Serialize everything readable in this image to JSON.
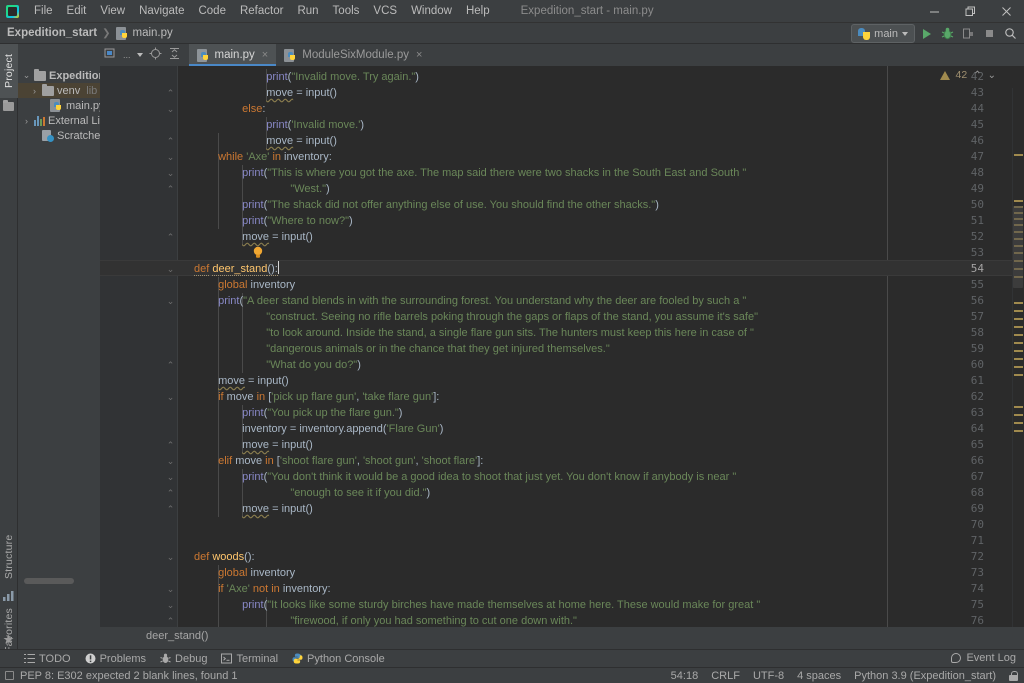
{
  "titlebar": {
    "window_title": "Expedition_start - main.py",
    "logo_name": "pycharm-logo",
    "menus": [
      "File",
      "Edit",
      "View",
      "Navigate",
      "Code",
      "Refactor",
      "Run",
      "Tools",
      "VCS",
      "Window",
      "Help"
    ],
    "controls": [
      "minimize",
      "maximize",
      "close"
    ]
  },
  "navbar": {
    "project": "Expedition_start",
    "separator": "❯",
    "file": "main.py"
  },
  "runbar": {
    "config_name": "main",
    "buttons": [
      "run",
      "debug",
      "run-coverage",
      "stop",
      "search-everywhere"
    ]
  },
  "left_tool_strip": {
    "tabs": [
      "Project",
      "Structure",
      "Favorites"
    ],
    "selected": "Project"
  },
  "project_pane": {
    "toolbar_label": "...",
    "tree": [
      {
        "indent": 0,
        "twisty": "⌄",
        "icon": "folder-icon",
        "label": "Expedition",
        "bold": true,
        "selected": false
      },
      {
        "indent": 1,
        "twisty": "›",
        "icon": "folder-icon",
        "label": "venv",
        "suffix": "lib",
        "selected": true
      },
      {
        "indent": 2,
        "twisty": "",
        "icon": "python-file-icon",
        "label": "main.py",
        "selected": false
      },
      {
        "indent": 0,
        "twisty": "›",
        "icon": "library-icon",
        "label": "External Lib",
        "selected": false
      },
      {
        "indent": 1,
        "twisty": "",
        "icon": "scratches-icon",
        "label": "Scratches an",
        "selected": false
      }
    ]
  },
  "editor": {
    "tabs": [
      {
        "label": "main.py",
        "active": true,
        "icon": "python-file-icon",
        "close": "×"
      },
      {
        "label": "ModuleSixModule.py",
        "active": false,
        "icon": "python-file-icon",
        "close": "×"
      }
    ],
    "toolbar_icons": [
      "select-in-icon",
      "locate-icon",
      "collapse-all-icon"
    ],
    "inspections": {
      "warning_count": "42",
      "up": "⌃",
      "down": "⌄"
    },
    "breadcrumb": "deer_stand()",
    "current_line": 54,
    "first_line": 42,
    "lines": [
      {
        "n": 42,
        "fold": "",
        "indent": 3,
        "tokens": [
          {
            "t": "print",
            "c": "call"
          },
          {
            "t": "(",
            "c": "id"
          },
          {
            "t": "\"Invalid move. Try again.\"",
            "c": "s"
          },
          {
            "t": ")",
            "c": "id"
          }
        ]
      },
      {
        "n": 43,
        "fold": "⌃",
        "indent": 3,
        "tokens": [
          {
            "t": "move",
            "c": "id warnu"
          },
          {
            "t": " = ",
            "c": "id"
          },
          {
            "t": "input",
            "c": "id"
          },
          {
            "t": "()",
            "c": "id"
          }
        ]
      },
      {
        "n": 44,
        "fold": "⌄",
        "indent": 2,
        "tokens": [
          {
            "t": "else",
            "c": "k"
          },
          {
            "t": ":",
            "c": "id"
          }
        ]
      },
      {
        "n": 45,
        "fold": "",
        "indent": 3,
        "tokens": [
          {
            "t": "print",
            "c": "call"
          },
          {
            "t": "(",
            "c": "id"
          },
          {
            "t": "'Invalid move.'",
            "c": "s"
          },
          {
            "t": ")",
            "c": "id"
          }
        ]
      },
      {
        "n": 46,
        "fold": "⌃",
        "indent": 3,
        "tokens": [
          {
            "t": "move",
            "c": "id warnu"
          },
          {
            "t": " = ",
            "c": "id"
          },
          {
            "t": "input",
            "c": "id"
          },
          {
            "t": "()",
            "c": "id"
          }
        ]
      },
      {
        "n": 47,
        "fold": "⌄",
        "indent": 1,
        "tokens": [
          {
            "t": "while",
            "c": "k"
          },
          {
            "t": " ",
            "c": "id"
          },
          {
            "t": "'Axe'",
            "c": "s"
          },
          {
            "t": " ",
            "c": "id"
          },
          {
            "t": "in",
            "c": "k"
          },
          {
            "t": " inventory:",
            "c": "id"
          }
        ]
      },
      {
        "n": 48,
        "fold": "⌄",
        "indent": 2,
        "tokens": [
          {
            "t": "print",
            "c": "call"
          },
          {
            "t": "(",
            "c": "id"
          },
          {
            "t": "\"This is where you got the axe. The map said there were two shacks in the South East and South \"",
            "c": "s"
          }
        ]
      },
      {
        "n": 49,
        "fold": "⌃",
        "indent": 4,
        "tokens": [
          {
            "t": "\"West.\"",
            "c": "s"
          },
          {
            "t": ")",
            "c": "id"
          }
        ]
      },
      {
        "n": 50,
        "fold": "",
        "indent": 2,
        "tokens": [
          {
            "t": "print",
            "c": "call"
          },
          {
            "t": "(",
            "c": "id"
          },
          {
            "t": "\"The shack did not offer anything else of use. You should find the other shacks.\"",
            "c": "s"
          },
          {
            "t": ")",
            "c": "id"
          }
        ]
      },
      {
        "n": 51,
        "fold": "",
        "indent": 2,
        "tokens": [
          {
            "t": "print",
            "c": "call"
          },
          {
            "t": "(",
            "c": "id"
          },
          {
            "t": "\"Where to now?\"",
            "c": "s"
          },
          {
            "t": ")",
            "c": "id"
          }
        ]
      },
      {
        "n": 52,
        "fold": "⌃",
        "indent": 2,
        "tokens": [
          {
            "t": "move",
            "c": "id warnu"
          },
          {
            "t": " = ",
            "c": "id"
          },
          {
            "t": "input",
            "c": "id"
          },
          {
            "t": "()",
            "c": "id"
          }
        ]
      },
      {
        "n": 53,
        "fold": "",
        "indent": 0,
        "bulb": true,
        "tokens": []
      },
      {
        "n": 54,
        "fold": "⌄",
        "indent": 0,
        "current": true,
        "tokens": [
          {
            "t": "def",
            "c": "k errdotted"
          },
          {
            "t": " ",
            "c": "id"
          },
          {
            "t": "deer_stand",
            "c": "fn errdotted"
          },
          {
            "t": "():",
            "c": "id errdotted"
          }
        ],
        "caret": true
      },
      {
        "n": 55,
        "fold": "",
        "indent": 1,
        "tokens": [
          {
            "t": "global",
            "c": "k"
          },
          {
            "t": " inventory",
            "c": "id"
          }
        ]
      },
      {
        "n": 56,
        "fold": "⌄",
        "indent": 1,
        "tokens": [
          {
            "t": "print",
            "c": "call"
          },
          {
            "t": "(",
            "c": "id"
          },
          {
            "t": "\"A deer stand blends in with the surrounding forest. You understand why the deer are fooled by such a \"",
            "c": "s"
          }
        ]
      },
      {
        "n": 57,
        "fold": "",
        "indent": 3,
        "tokens": [
          {
            "t": "\"construct. Seeing no rifle barrels poking through the gaps or flaps of the stand, you assume it's safe\"",
            "c": "s"
          }
        ]
      },
      {
        "n": 58,
        "fold": "",
        "indent": 3,
        "tokens": [
          {
            "t": "\"to look around. Inside the stand, a single flare gun sits. The hunters must keep this here in case of \"",
            "c": "s"
          }
        ]
      },
      {
        "n": 59,
        "fold": "",
        "indent": 3,
        "tokens": [
          {
            "t": "\"dangerous animals or in the chance that they get injured themselves.\"",
            "c": "s"
          }
        ]
      },
      {
        "n": 60,
        "fold": "⌃",
        "indent": 3,
        "tokens": [
          {
            "t": "\"What do you do?\"",
            "c": "s"
          },
          {
            "t": ")",
            "c": "id"
          }
        ]
      },
      {
        "n": 61,
        "fold": "",
        "indent": 1,
        "tokens": [
          {
            "t": "move",
            "c": "id warnu"
          },
          {
            "t": " = ",
            "c": "id"
          },
          {
            "t": "input",
            "c": "id"
          },
          {
            "t": "()",
            "c": "id"
          }
        ]
      },
      {
        "n": 62,
        "fold": "⌄",
        "indent": 1,
        "tokens": [
          {
            "t": "if",
            "c": "k"
          },
          {
            "t": " move ",
            "c": "id"
          },
          {
            "t": "in",
            "c": "k"
          },
          {
            "t": " [",
            "c": "id"
          },
          {
            "t": "'pick up flare gun'",
            "c": "s"
          },
          {
            "t": ", ",
            "c": "id"
          },
          {
            "t": "'take flare gun'",
            "c": "s"
          },
          {
            "t": "]:",
            "c": "id"
          }
        ]
      },
      {
        "n": 63,
        "fold": "",
        "indent": 2,
        "tokens": [
          {
            "t": "print",
            "c": "call"
          },
          {
            "t": "(",
            "c": "id"
          },
          {
            "t": "\"You pick up the flare gun.\"",
            "c": "s"
          },
          {
            "t": ")",
            "c": "id"
          }
        ]
      },
      {
        "n": 64,
        "fold": "",
        "indent": 2,
        "tokens": [
          {
            "t": "inventory = inventory.append(",
            "c": "id"
          },
          {
            "t": "'Flare Gun'",
            "c": "s"
          },
          {
            "t": ")",
            "c": "id"
          }
        ]
      },
      {
        "n": 65,
        "fold": "⌃",
        "indent": 2,
        "tokens": [
          {
            "t": "move",
            "c": "id warnu"
          },
          {
            "t": " = ",
            "c": "id"
          },
          {
            "t": "input",
            "c": "id"
          },
          {
            "t": "()",
            "c": "id"
          }
        ]
      },
      {
        "n": 66,
        "fold": "⌄",
        "indent": 1,
        "tokens": [
          {
            "t": "elif",
            "c": "k"
          },
          {
            "t": " move ",
            "c": "id"
          },
          {
            "t": "in",
            "c": "k"
          },
          {
            "t": " [",
            "c": "id"
          },
          {
            "t": "'shoot flare gun'",
            "c": "s"
          },
          {
            "t": ", ",
            "c": "id"
          },
          {
            "t": "'shoot gun'",
            "c": "s"
          },
          {
            "t": ", ",
            "c": "id"
          },
          {
            "t": "'shoot flare'",
            "c": "s"
          },
          {
            "t": "]:",
            "c": "id"
          }
        ]
      },
      {
        "n": 67,
        "fold": "⌄",
        "indent": 2,
        "tokens": [
          {
            "t": "print",
            "c": "call"
          },
          {
            "t": "(",
            "c": "id"
          },
          {
            "t": "\"You don't think it would be a good idea to shoot that just yet. You don't know if anybody is near \"",
            "c": "s"
          }
        ]
      },
      {
        "n": 68,
        "fold": "⌃",
        "indent": 4,
        "tokens": [
          {
            "t": "\"enough to see it if you did.\"",
            "c": "s"
          },
          {
            "t": ")",
            "c": "id"
          }
        ]
      },
      {
        "n": 69,
        "fold": "⌃",
        "indent": 2,
        "tokens": [
          {
            "t": "move",
            "c": "id warnu"
          },
          {
            "t": " = ",
            "c": "id"
          },
          {
            "t": "input",
            "c": "id"
          },
          {
            "t": "()",
            "c": "id"
          }
        ]
      },
      {
        "n": 70,
        "fold": "",
        "indent": 0,
        "tokens": []
      },
      {
        "n": 71,
        "fold": "",
        "indent": 0,
        "tokens": []
      },
      {
        "n": 72,
        "fold": "⌄",
        "indent": 0,
        "tokens": [
          {
            "t": "def",
            "c": "k"
          },
          {
            "t": " ",
            "c": "id"
          },
          {
            "t": "woods",
            "c": "fn"
          },
          {
            "t": "():",
            "c": "id"
          }
        ]
      },
      {
        "n": 73,
        "fold": "",
        "indent": 1,
        "tokens": [
          {
            "t": "global",
            "c": "k"
          },
          {
            "t": " inventory",
            "c": "id"
          }
        ]
      },
      {
        "n": 74,
        "fold": "⌄",
        "indent": 1,
        "tokens": [
          {
            "t": "if",
            "c": "k"
          },
          {
            "t": " ",
            "c": "id"
          },
          {
            "t": "'Axe'",
            "c": "s"
          },
          {
            "t": " ",
            "c": "id"
          },
          {
            "t": "not",
            "c": "k"
          },
          {
            "t": " ",
            "c": "id"
          },
          {
            "t": "in",
            "c": "k"
          },
          {
            "t": " inventory:",
            "c": "id"
          }
        ]
      },
      {
        "n": 75,
        "fold": "⌄",
        "indent": 2,
        "tokens": [
          {
            "t": "print",
            "c": "call"
          },
          {
            "t": "(",
            "c": "id"
          },
          {
            "t": "\"It looks like some sturdy birches have made themselves at home here. These would make for great \"",
            "c": "s"
          }
        ]
      },
      {
        "n": 76,
        "fold": "⌃",
        "indent": 4,
        "tokens": [
          {
            "t": "\"firewood, if only you had something to cut one down with.\"",
            "c": "s"
          }
        ]
      }
    ]
  },
  "bottom_tool_bar": {
    "items": [
      {
        "label": "TODO",
        "icon": "todo-icon"
      },
      {
        "label": "Problems",
        "icon": "problems-icon"
      },
      {
        "label": "Debug",
        "icon": "debug-icon"
      },
      {
        "label": "Terminal",
        "icon": "terminal-icon"
      },
      {
        "label": "Python Console",
        "icon": "python-console-icon"
      }
    ],
    "event_log": "Event Log"
  },
  "statusbar": {
    "message": "PEP 8: E302 expected 2 blank lines, found 1",
    "caret_position": "54:18",
    "line_separator": "CRLF",
    "encoding": "UTF-8",
    "indent": "4 spaces",
    "interpreter": "Python 3.9 (Expedition_start)",
    "lock_icon": "write-access-icon"
  }
}
